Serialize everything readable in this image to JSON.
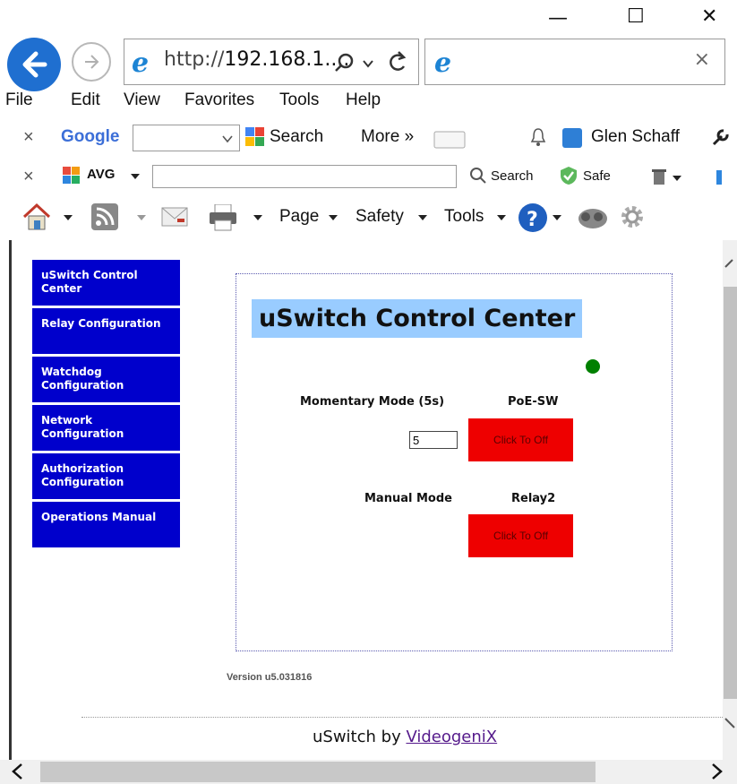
{
  "window": {
    "minimize_glyph": "—",
    "maximize_glyph": "☐",
    "close_glyph": "✕"
  },
  "address_bar": {
    "url_prefix": "http://",
    "url_host": "192.168.1....",
    "tab_close": "×"
  },
  "menu": [
    "File",
    "Edit",
    "View",
    "Favorites",
    "Tools",
    "Help"
  ],
  "google_toolbar": {
    "close": "×",
    "brand": "Google",
    "search_label": "Search",
    "more_label": "More »",
    "user_name": "Glen Schaff"
  },
  "avg_toolbar": {
    "close": "×",
    "brand": "AVG",
    "search_label": "Search",
    "safe_label": "Safe"
  },
  "command_bar": {
    "page": "Page",
    "safety": "Safety",
    "tools": "Tools"
  },
  "nav": [
    "uSwitch Control Center",
    "Relay Configuration",
    "Watchdog Configuration",
    "Network Configuration",
    "Authorization Configuration",
    "Operations Manual"
  ],
  "main": {
    "title": "uSwitch Control Center",
    "momentary_label": "Momentary Mode (5s)",
    "relay1_name": "PoE-SW",
    "momentary_value": "5",
    "relay1_button": "Click To Off",
    "manual_label": "Manual Mode",
    "relay2_name": "Relay2",
    "relay2_button": "Click To Off",
    "status_color": "#008000"
  },
  "version": "Version u5.031816",
  "footer": {
    "prefix": "uSwitch by ",
    "link": "VideogeniX"
  },
  "colors": {
    "nav_bg": "#0000cc",
    "title_bg": "#99ccff",
    "button_red": "#ee0000"
  }
}
